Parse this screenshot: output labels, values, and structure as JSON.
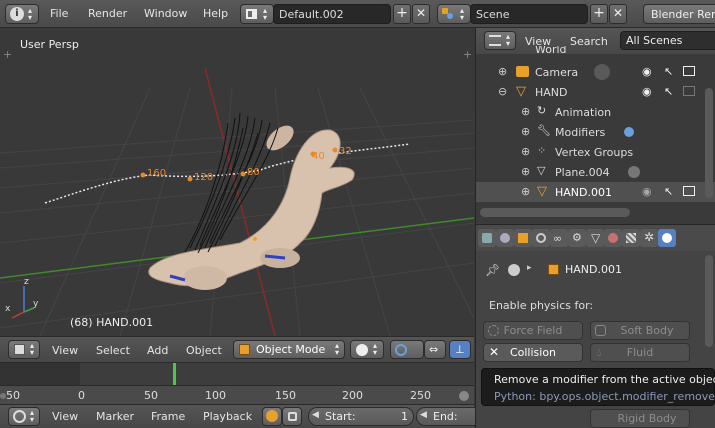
{
  "top_menu": {
    "items": [
      "File",
      "Render",
      "Window",
      "Help"
    ],
    "screen_layout": "Default.002",
    "scene": "Scene",
    "engine": "Blender Rend"
  },
  "viewport": {
    "view_label": "User Persp",
    "object_label": "(68) HAND.001",
    "path_labels": [
      "160",
      "120",
      "80",
      "40",
      "32"
    ]
  },
  "viewport_header": {
    "menus": [
      "View",
      "Select",
      "Add",
      "Object"
    ],
    "mode": "Object Mode"
  },
  "timeline": {
    "ticks": [
      "-50",
      "0",
      "50",
      "100",
      "150",
      "200",
      "250"
    ],
    "current_frame": 68
  },
  "timeline_header": {
    "menus": [
      "View",
      "Marker",
      "Frame",
      "Playback"
    ],
    "start_label": "Start:",
    "start_value": "1",
    "end_label": "End:"
  },
  "outliner": {
    "view": "View",
    "search": "Search",
    "filter": "All Scenes",
    "rows": [
      {
        "label": "World"
      },
      {
        "label": "Camera"
      },
      {
        "label": "HAND"
      },
      {
        "label": "Animation"
      },
      {
        "label": "Modifiers"
      },
      {
        "label": "Vertex Groups"
      },
      {
        "label": "Plane.004"
      },
      {
        "label": "HAND.001"
      }
    ]
  },
  "properties": {
    "object_name": "HAND.001",
    "enable_label": "Enable physics for:",
    "buttons": {
      "force_field": "Force Field",
      "soft_body": "Soft Body",
      "collision": "Collision",
      "fluid": "Fluid",
      "rigid_body_con": "Rigid Body Co..."
    }
  },
  "tooltip": {
    "title": "Remove a modifier from the active object",
    "python": "Python: bpy.ops.object.modifier_remove()"
  },
  "colors": {
    "accent_orange": "#e8882a",
    "selection_blue": "#5680c2",
    "grid_red": "#8a2a2a",
    "grid_green": "#3f8a2a",
    "frame_green": "#4fc44f"
  }
}
